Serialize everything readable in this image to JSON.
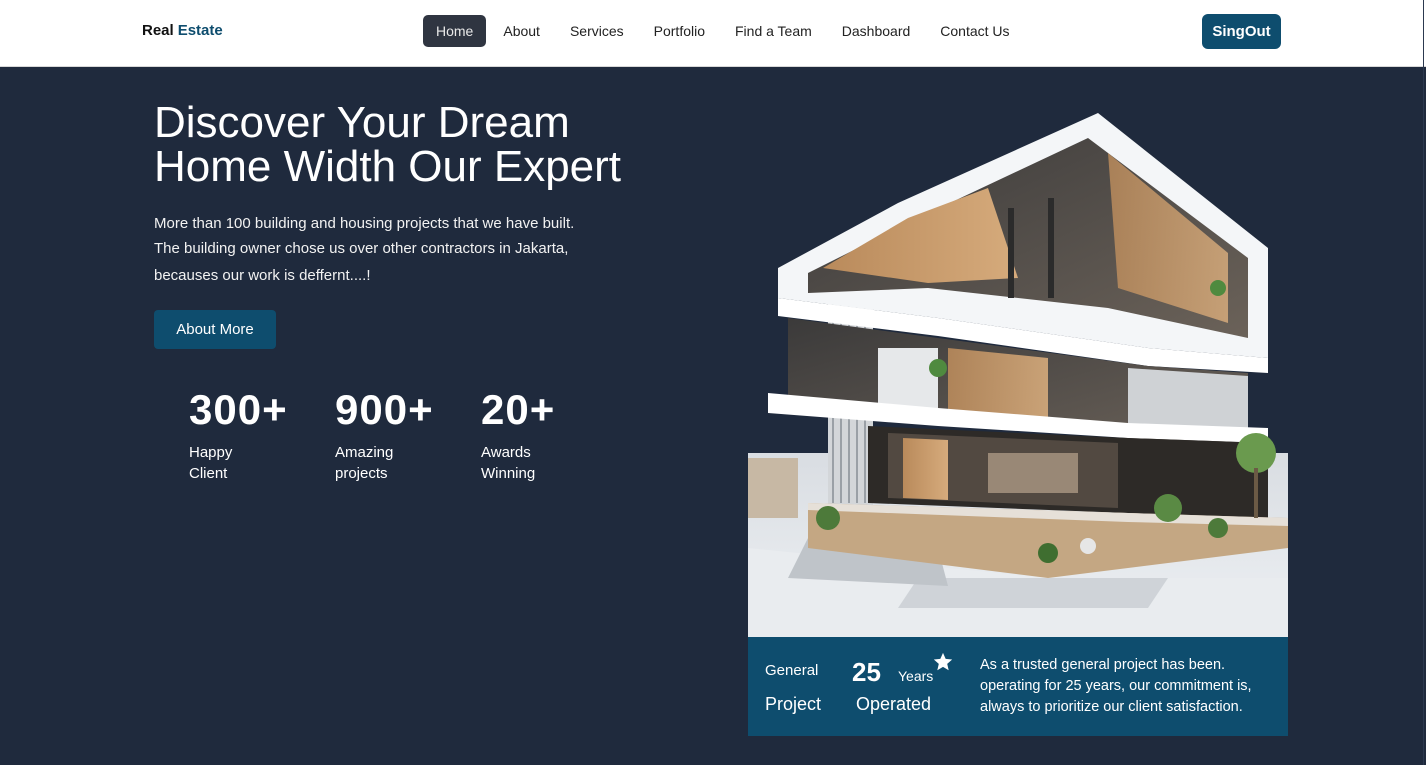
{
  "nav": {
    "brand_first": "Real",
    "brand_second": "Estate",
    "items": [
      "Home",
      "About",
      "Services",
      "Portfolio",
      "Find a Team",
      "Dashboard",
      "Contact Us"
    ],
    "active": "Home",
    "signout_label": "SingOut"
  },
  "hero": {
    "title_line1": "Discover Your Dream",
    "title_line2": "Home Width Our Expert",
    "desc_line1": "More than 100 building and housing projects that we have built.",
    "desc_line2": "The building owner chose us over other contractors in Jakarta,",
    "desc_line3": "becauses our work is deffernt....!",
    "button_label": "About More"
  },
  "stats": [
    {
      "value": "300+",
      "label_line1": "Happy",
      "label_line2": "Client"
    },
    {
      "value": "900+",
      "label_line1": "Amazing",
      "label_line2": "projects"
    },
    {
      "value": "20+",
      "label_line1": "Awards",
      "label_line2": "Winning"
    }
  ],
  "info_card": {
    "general": "General",
    "project": "Project",
    "years_number": "25",
    "years_label": "Years",
    "operated": "Operated",
    "text": "As a trusted general project has been. operating for 25 years, our commitment is, always to prioritize our client satisfaction.",
    "icon": "star-icon"
  },
  "colors": {
    "background": "#1f2a3d",
    "accent": "#0e4d6e",
    "nav_active": "#2f3541"
  }
}
